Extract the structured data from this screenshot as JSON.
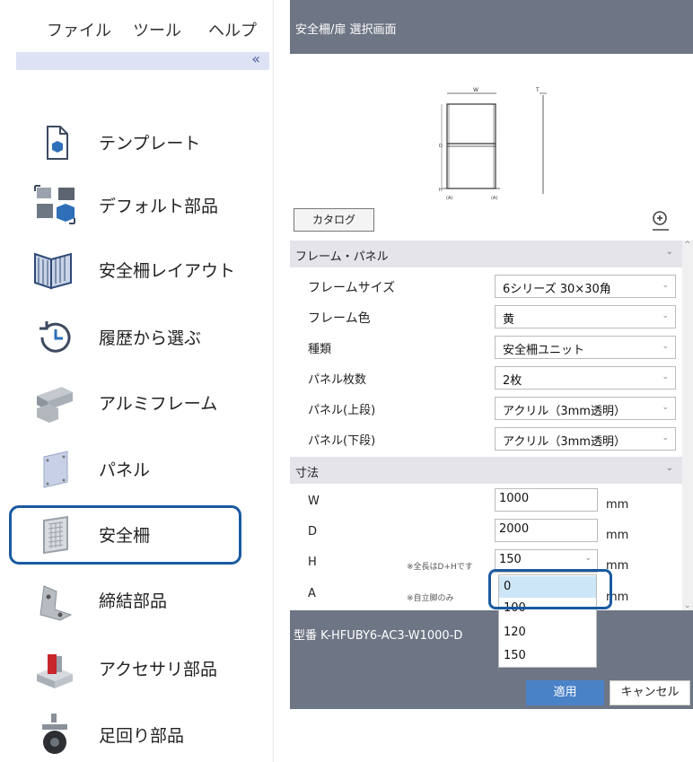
{
  "menu": {
    "file": "ファイル",
    "tools": "ツール",
    "help": "ヘルプ",
    "collapse": "«"
  },
  "nav": {
    "items": [
      {
        "label": "テンプレート",
        "icon": "template-icon"
      },
      {
        "label": "デフォルト部品",
        "icon": "default-parts-icon"
      },
      {
        "label": "安全柵レイアウト",
        "icon": "safety-fence-layout-icon"
      },
      {
        "label": "履歴から選ぶ",
        "icon": "history-icon"
      },
      {
        "label": "アルミフレーム",
        "icon": "aluminum-frame-icon"
      },
      {
        "label": "パネル",
        "icon": "panel-icon"
      },
      {
        "label": "安全柵",
        "icon": "safety-fence-icon"
      },
      {
        "label": "締結部品",
        "icon": "fastener-icon"
      },
      {
        "label": "アクセサリ部品",
        "icon": "accessory-icon"
      },
      {
        "label": "足回り部品",
        "icon": "caster-icon"
      }
    ],
    "selected": "安全柵"
  },
  "dialog": {
    "title": "安全柵/扉  選択画面",
    "preview": {
      "w_label": "W",
      "t_label": "T",
      "d_label": "D",
      "h_label": "H",
      "a_label_left": "(A)",
      "a_label_right": "(A)"
    },
    "catalog_button": "カタログ",
    "zoom_icon": "zoom-in-icon",
    "sections": {
      "frame_panel": {
        "title": "フレーム・パネル",
        "rows": [
          {
            "label": "フレームサイズ",
            "value": "6シリーズ  30×30角"
          },
          {
            "label": "フレーム色",
            "value": "黄"
          },
          {
            "label": "種類",
            "value": "安全柵ユニット"
          },
          {
            "label": "パネル枚数",
            "value": "2枚"
          },
          {
            "label": "パネル(上段)",
            "value": "アクリル（3mm透明）"
          },
          {
            "label": "パネル(下段)",
            "value": "アクリル（3mm透明）"
          }
        ]
      },
      "dimensions": {
        "title": "寸法",
        "w": {
          "label": "W",
          "value": "1000",
          "unit": "mm"
        },
        "d": {
          "label": "D",
          "value": "2000",
          "unit": "mm"
        },
        "h": {
          "label": "H",
          "value": "150",
          "unit": "mm",
          "note": "※全長はD+Hです"
        },
        "a": {
          "label": "A",
          "unit": "mm",
          "note": "※自立脚のみ"
        }
      }
    },
    "model": "型番  K-HFUBY6-AC3-W1000-D",
    "apply_button": "適用",
    "cancel_button": "キャンセル"
  },
  "dropdown": {
    "options": [
      "0",
      "100",
      "120",
      "150"
    ],
    "highlighted": "0"
  }
}
